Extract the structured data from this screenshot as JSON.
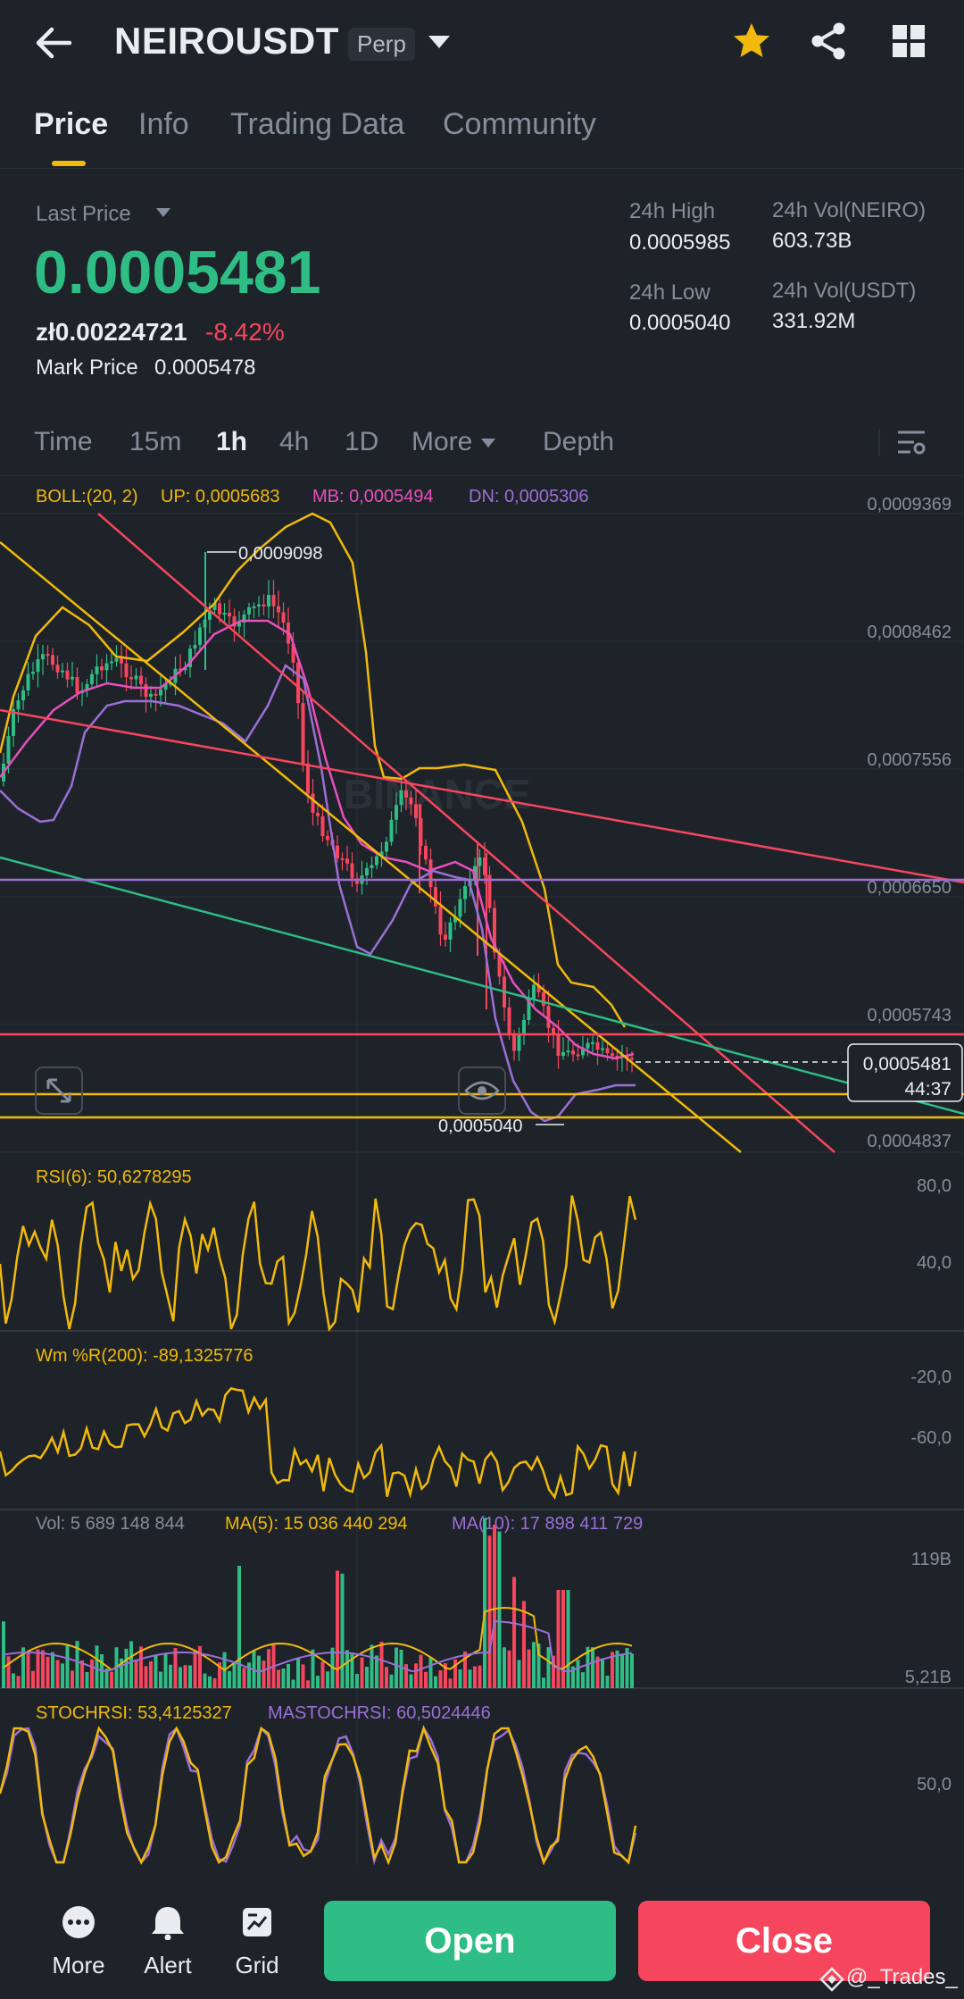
{
  "header": {
    "pair": "NEIROUSDT",
    "badge": "Perp"
  },
  "tabs": [
    "Price",
    "Info",
    "Trading Data",
    "Community"
  ],
  "price": {
    "last_price_label": "Last Price",
    "last_price": "0.0005481",
    "fiat": "zł0.00224721",
    "change": "-8.42%",
    "mark_label": "Mark Price",
    "mark_value": "0.0005478",
    "high_label": "24h High",
    "high_value": "0.0005985",
    "low_label": "24h Low",
    "low_value": "0.0005040",
    "vol_base_label": "24h Vol(NEIRO)",
    "vol_base_value": "603.73B",
    "vol_quote_label": "24h Vol(USDT)",
    "vol_quote_value": "331.92M"
  },
  "timeframes": [
    "Time",
    "15m",
    "1h",
    "4h",
    "1D",
    "More",
    "Depth"
  ],
  "chart": {
    "boll_label": "BOLL:(20, 2)",
    "boll_up": "UP: 0,0005683",
    "boll_mb": "MB: 0,0005494",
    "boll_dn": "DN: 0,0005306",
    "price_axis": [
      "0,0009369",
      "0,0008462",
      "0,0007556",
      "0,0006650",
      "0,0005743",
      "0,0004837"
    ],
    "high_marker": "0,0009098",
    "low_marker": "0,0005040",
    "watermark": "BINANCE",
    "current_price_tag": "0,0005481",
    "countdown": "44:37",
    "rsi_label": "RSI(6): 50,6278295",
    "rsi_axis": [
      "80,0",
      "40,0"
    ],
    "wr_label": "Wm %R(200): -89,1325776",
    "wr_axis": [
      "-20,0",
      "-60,0"
    ],
    "vol_label": "Vol: 5 689 148 844",
    "vol_ma5": "MA(5): 15 036 440 294",
    "vol_ma10": "MA(10): 17 898 411 729",
    "vol_axis": [
      "119B",
      "5,21B"
    ],
    "stoch_label": "STOCHRSI: 53,4125327",
    "stoch_ma": "MASTOCHRSI: 60,5024446",
    "stoch_axis": [
      "50,0"
    ]
  },
  "bottom": {
    "more": "More",
    "alert": "Alert",
    "grid": "Grid",
    "open": "Open",
    "close": "Close",
    "watermark": "@_Trades_"
  },
  "colors": {
    "up": "#2ebd85",
    "down": "#f6465d",
    "accent": "#f0b90b",
    "boll_mb": "#e84fbd",
    "boll_dn": "#9b6fd6"
  }
}
